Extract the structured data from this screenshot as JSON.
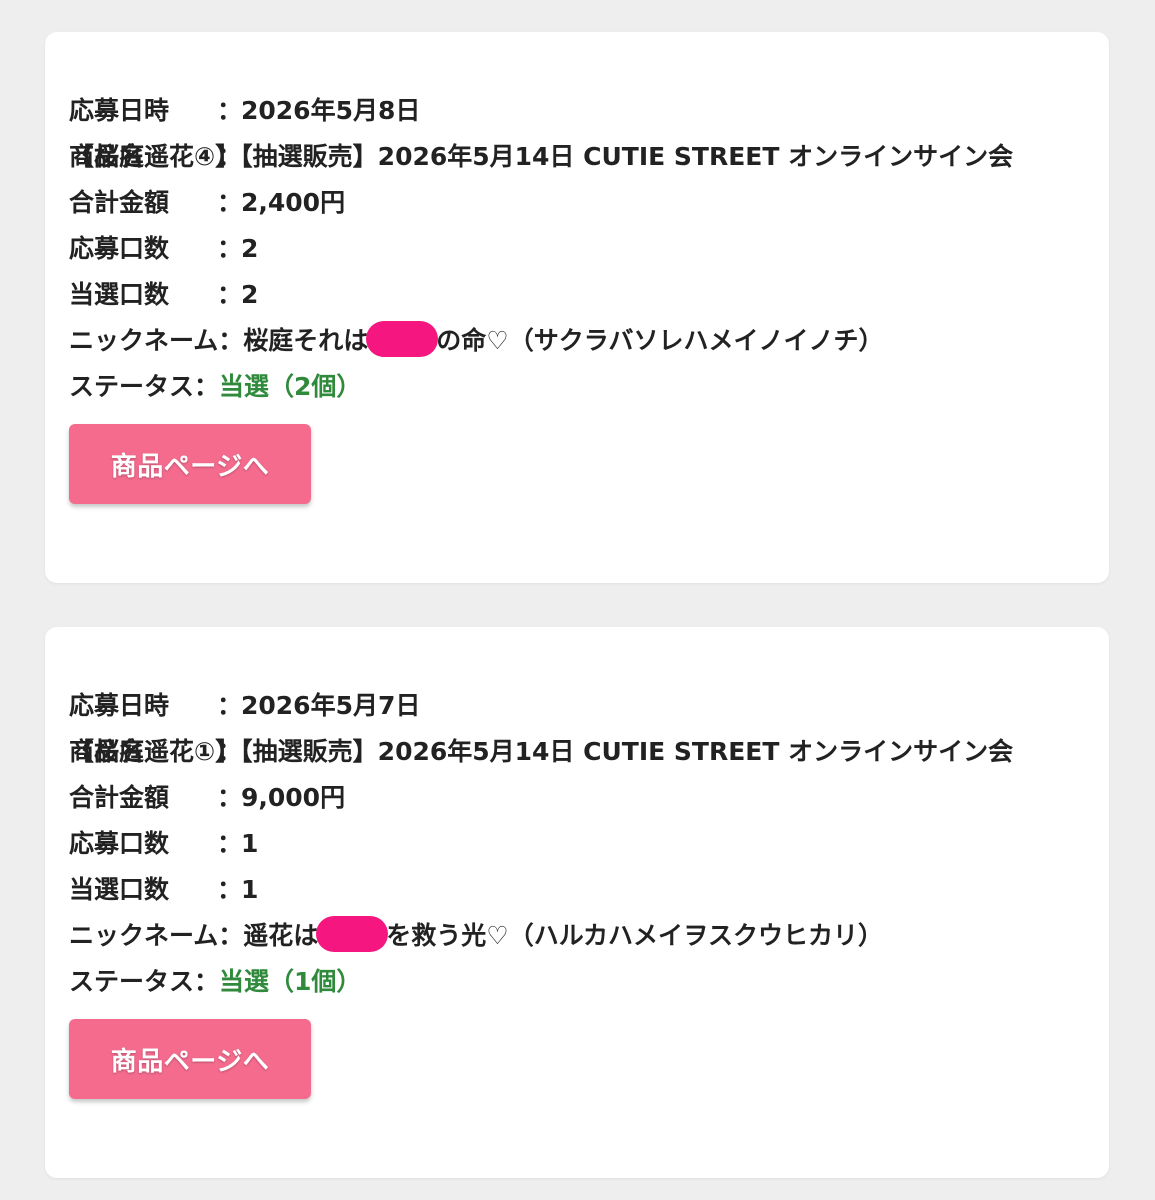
{
  "colors": {
    "page_bg": "#eeeeee",
    "card_bg": "#ffffff",
    "status_win": "#2f8a3b",
    "button_bg": "#f46b8e",
    "redaction": "#f5177f"
  },
  "labels": {
    "date": "応募日時",
    "product": "商品名",
    "total": "合計金額",
    "entries": "応募口数",
    "won": "当選口数",
    "nickname": "ニックネーム",
    "status": "ステータス",
    "colon": "：",
    "button": "商品ページへ"
  },
  "entries": [
    {
      "date": "2026年5月8日",
      "product": "【桜庭遥花④】【抽選販売】2026年5月14日 CUTIE STREET オンラインサイン会",
      "total": "2,400円",
      "entries": "2",
      "won": "2",
      "nickname_before": "桜庭それは",
      "nickname_after": "の命♡（サクラバソレハメイノイノチ）",
      "status": "当選（2個）"
    },
    {
      "date": "2026年5月7日",
      "product": "【桜庭遥花①】【抽選販売】2026年5月14日 CUTIE STREET オンラインサイン会",
      "total": "9,000円",
      "entries": "1",
      "won": "1",
      "nickname_before": "遥花は",
      "nickname_after": "を救う光♡（ハルカハメイヲスクウヒカリ）",
      "status": "当選（1個）"
    }
  ]
}
